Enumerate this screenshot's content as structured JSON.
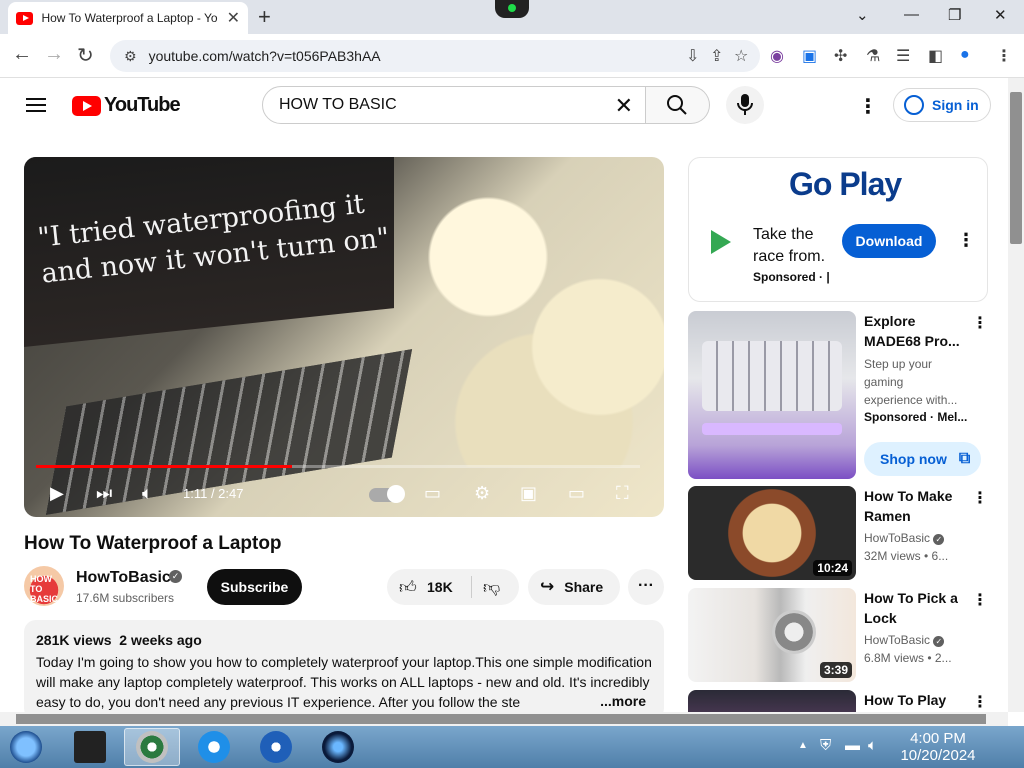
{
  "browser": {
    "tab_title": "How To Waterproof a Laptop - Yo",
    "url": "youtube.com/watch?v=t056PAB3hAA"
  },
  "youtube": {
    "logo_text": "YouTube",
    "search_value": "HOW TO BASIC",
    "sign_in": "Sign in"
  },
  "player": {
    "overlay_text": "\"I tried waterproofing it and now it won't turn on\"",
    "time": "1:11 / 2:47",
    "progress_fraction": 0.424
  },
  "video": {
    "title": "How To Waterproof a Laptop",
    "channel": "HowToBasic",
    "avatar_text": "HOW TO BASIC",
    "subscribers": "17.6M subscribers",
    "subscribe_label": "Subscribe",
    "likes": "18K",
    "share_label": "Share",
    "views": "281K views",
    "age": "2 weeks ago",
    "description": "Today I'm going to show you how to completely waterproof your laptop.This one simple modification will make any laptop completely waterproof. This works on ALL laptops - new and old. It's incredibly easy to do, you don't need any previous IT experience. After you follow the ste",
    "more_label": "...more"
  },
  "ad": {
    "brand": "Go Play",
    "text_line1": "Take the",
    "text_line2": "race from.",
    "sponsored": "Sponsored · |",
    "download": "Download"
  },
  "sidebar": [
    {
      "title": "Explore MADE68 Pro...",
      "line2": "Step up your gaming experience with...",
      "meta": "Sponsored · Mel...",
      "cta": "Shop now"
    },
    {
      "title": "How To Make Ramen",
      "channel": "HowToBasic",
      "views": "32M views  • 6...",
      "duration": "10:24"
    },
    {
      "title": "How To Pick a Lock",
      "channel": "HowToBasic",
      "views": "6.8M views  • 2...",
      "duration": "3:39"
    },
    {
      "title": "How To Play"
    }
  ],
  "taskbar": {
    "time": "4:00 PM",
    "date": "10/20/2024"
  }
}
